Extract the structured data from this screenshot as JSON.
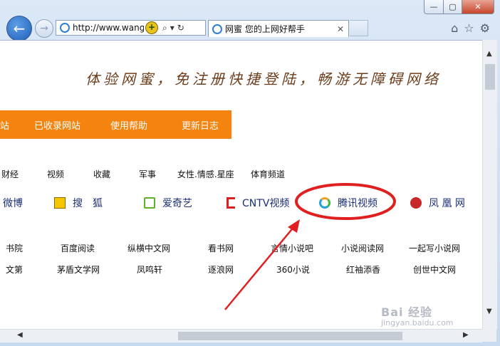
{
  "window": {
    "address_url": "http://www.wangr",
    "search_glyph": "⌕",
    "dropdown_glyph": "▾",
    "refresh_glyph": "↻",
    "tab_title": "网蜜 您的上网好帮手",
    "tab_close": "✕",
    "minimize_glyph": "—",
    "maximize_glyph": "▢",
    "close_glyph": "✕",
    "compat_glyph": "+",
    "back_glyph": "←",
    "forward_glyph": "→",
    "home_glyph": "⌂",
    "favorites_glyph": "☆",
    "settings_glyph": "⚙"
  },
  "page": {
    "banner": "体验网蜜，免注册快捷登陆，畅游无障碍网络",
    "orange_nav": [
      "站",
      "已收录网站",
      "使用帮助",
      "更新日志"
    ],
    "categories": [
      "财经",
      "视频",
      "收藏",
      "军事",
      "女性.情感.星座",
      "体育频道"
    ],
    "sites": [
      "微博",
      "搜　狐",
      "爱奇艺",
      "CNTV视频",
      "腾讯视频",
      "凤 凰 网"
    ],
    "links_row1": [
      "书院",
      "百度阅读",
      "纵横中文网",
      "看书网",
      "言情小说吧",
      "小说阅读网",
      "一起写小说网"
    ],
    "links_row2": [
      "文第",
      "茅盾文学网",
      "凤鸣轩",
      "逐浪网",
      "360小说",
      "红袖添香",
      "创世中文网"
    ]
  },
  "scroll": {
    "up_glyph": "▲",
    "down_glyph": "▼",
    "left_glyph": "◀",
    "right_glyph": "▶"
  },
  "watermark": {
    "brand": "Bai 经验",
    "url": "jingyan.baidu.com"
  },
  "colors": {
    "accent_orange": "#f5840f",
    "highlight_red": "#e02020",
    "banner_brown": "#6b3d1c",
    "site_link_blue": "#1a2e73"
  }
}
